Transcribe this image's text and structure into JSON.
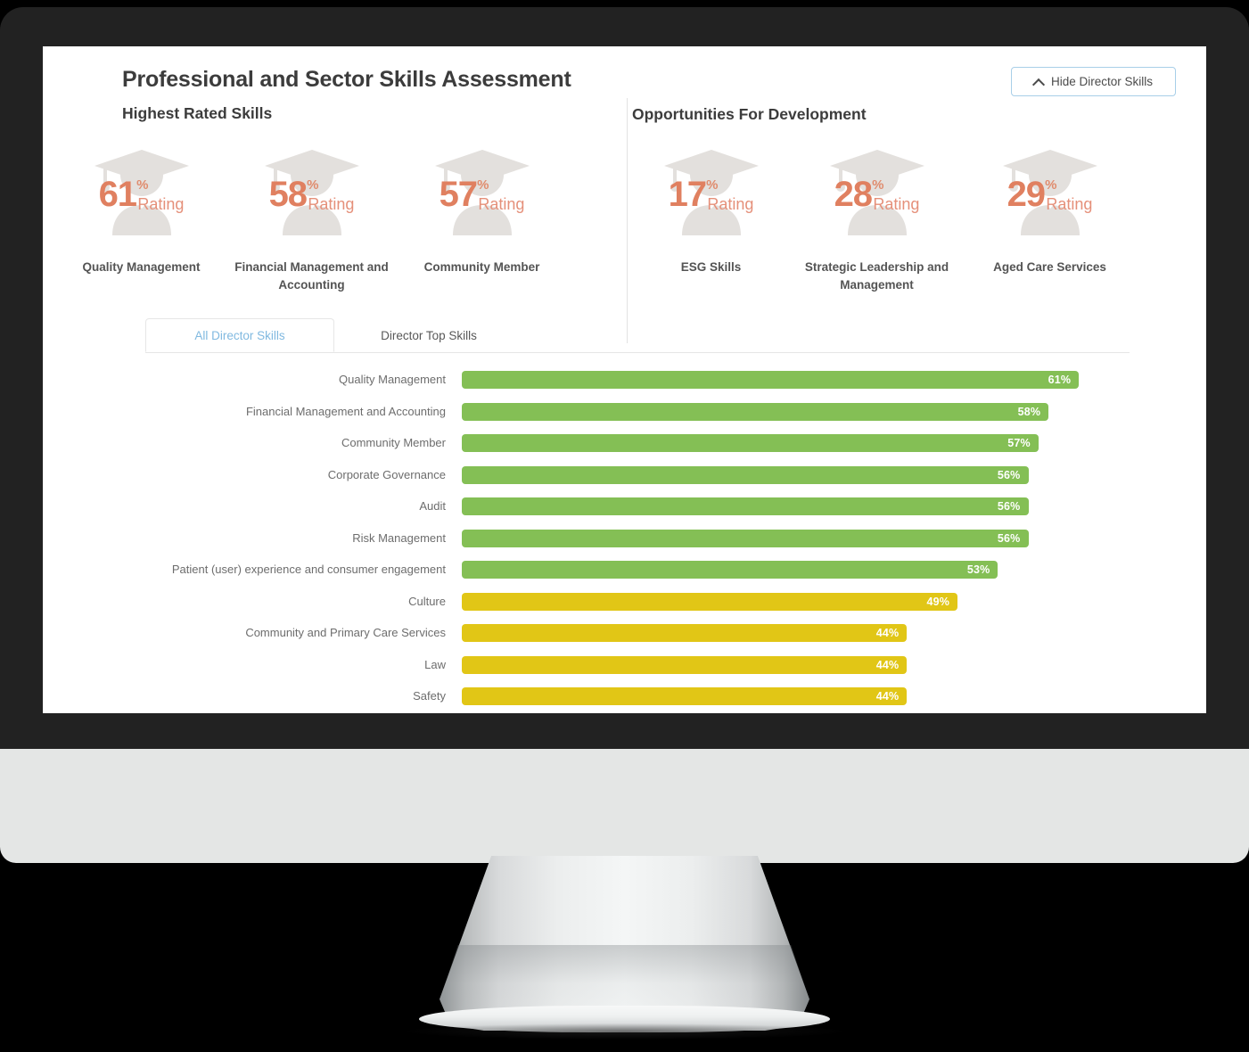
{
  "header": {
    "title": "Professional and Sector Skills Assessment",
    "toggle_button": {
      "label": "Hide Director Skills",
      "icon": "chevron-up-icon"
    }
  },
  "sections": {
    "highest_rated": {
      "heading": "Highest Rated Skills",
      "cards": [
        {
          "value": "61",
          "pct": "%",
          "word": "Rating",
          "label": "Quality Management"
        },
        {
          "value": "58",
          "pct": "%",
          "word": "Rating",
          "label": "Financial Management and Accounting"
        },
        {
          "value": "57",
          "pct": "%",
          "word": "Rating",
          "label": "Community Member"
        }
      ]
    },
    "opportunities": {
      "heading": "Opportunities For Development",
      "cards": [
        {
          "value": "17",
          "pct": "%",
          "word": "Rating",
          "label": "ESG Skills"
        },
        {
          "value": "28",
          "pct": "%",
          "word": "Rating",
          "label": "Strategic Leadership and Management"
        },
        {
          "value": "29",
          "pct": "%",
          "word": "Rating",
          "label": "Aged Care Services"
        }
      ]
    }
  },
  "tabs": [
    {
      "label": "All Director Skills",
      "active": true
    },
    {
      "label": "Director Top Skills",
      "active": false
    }
  ],
  "colors": {
    "green": "#84bf55",
    "yellow": "#e1c616",
    "orange": "#e08060",
    "accent_blue": "#80b9e0",
    "bezel": "#222222",
    "chin": "#e4e6e5"
  },
  "chart_data": {
    "type": "bar",
    "orientation": "horizontal",
    "title": "",
    "xlabel": "",
    "ylabel": "",
    "xlim": [
      0,
      66
    ],
    "grid": false,
    "legend": false,
    "value_suffix": "%",
    "categories": [
      "Quality Management",
      "Financial Management and Accounting",
      "Community Member",
      "Corporate Governance",
      "Audit",
      "Risk Management",
      "Patient (user) experience and consumer engagement",
      "Culture",
      "Community and Primary Care Services",
      "Law",
      "Safety"
    ],
    "values": [
      61,
      58,
      57,
      56,
      56,
      56,
      53,
      49,
      44,
      44,
      44
    ],
    "labels": [
      "61%",
      "58%",
      "57%",
      "56%",
      "56%",
      "56%",
      "53%",
      "49%",
      "44%",
      "44%",
      "44%"
    ],
    "bar_colors": [
      "#84bf55",
      "#84bf55",
      "#84bf55",
      "#84bf55",
      "#84bf55",
      "#84bf55",
      "#84bf55",
      "#e1c616",
      "#e1c616",
      "#e1c616",
      "#e1c616"
    ]
  }
}
